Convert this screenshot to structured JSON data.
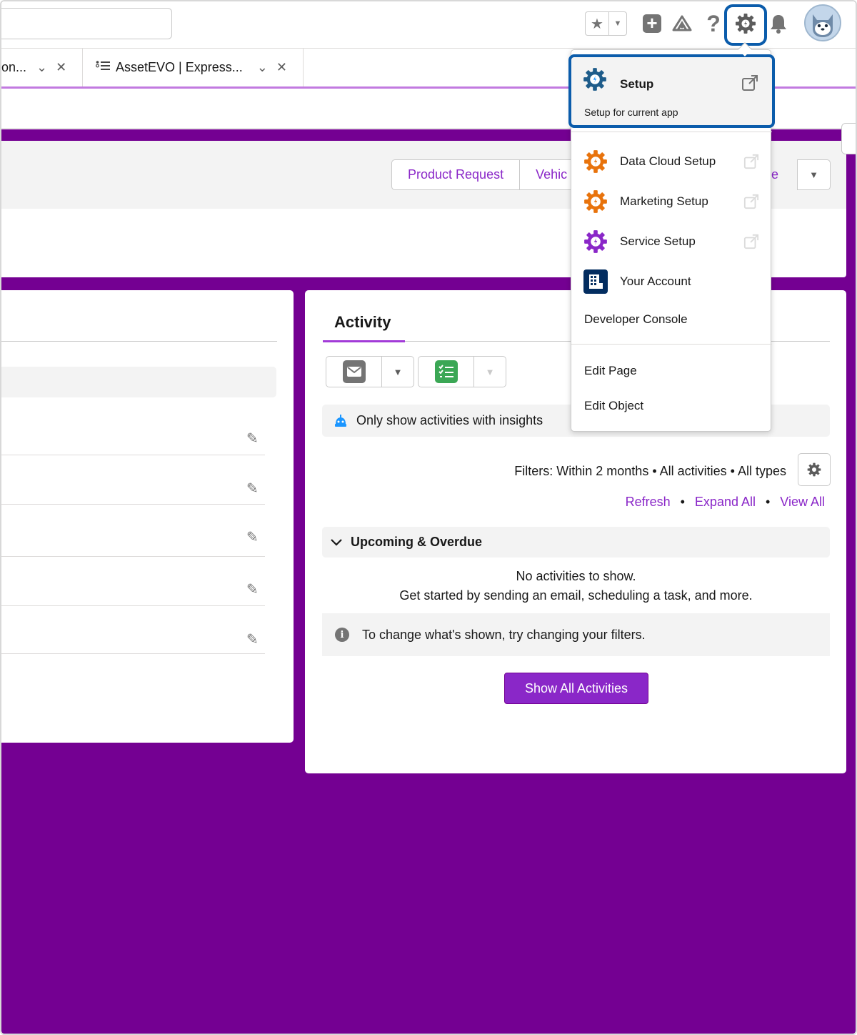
{
  "colors": {
    "brand_purple": "#740092",
    "link_purple": "#8a27c8",
    "focus_blue": "#0b5cab",
    "setup_gear": "#1e5c8a",
    "orange_gear": "#e8730c",
    "purple_gear": "#8a27c8"
  },
  "header": {
    "search_placeholder": "",
    "icons": [
      "star-icon",
      "chevron-down-icon",
      "add-icon",
      "trailhead-icon",
      "help-icon",
      "setup-gear-icon",
      "bell-icon",
      "avatar"
    ],
    "help_glyph": "?"
  },
  "tabs": [
    {
      "label": "on...",
      "icon": ""
    },
    {
      "label": "AssetEVO | Express...",
      "icon": "list-icon"
    }
  ],
  "highlights": {
    "actions": [
      "Product Request",
      "Vehic"
    ],
    "more_partial": "re"
  },
  "activity": {
    "title": "Activity",
    "insights_label": "Only show activities with insights",
    "filters": "Filters: Within 2 months • All activities • All types",
    "links": {
      "refresh": "Refresh",
      "expand": "Expand All",
      "view": "View All",
      "separator": "•"
    },
    "upcoming": "Upcoming & Overdue",
    "empty_line1": "No activities to show.",
    "empty_line2": "Get started by sending an email, scheduling a task, and more.",
    "tip": "To change what's shown, try changing your filters.",
    "show_all": "Show All Activities"
  },
  "setup_menu": {
    "setup": {
      "title": "Setup",
      "subtitle": "Setup for current app"
    },
    "items": [
      {
        "label": "Data Cloud Setup",
        "icon": "orange-gear-icon"
      },
      {
        "label": "Marketing Setup",
        "icon": "orange-gear-icon"
      },
      {
        "label": "Service Setup",
        "icon": "purple-gear-icon"
      },
      {
        "label": "Your Account",
        "icon": "building-icon"
      },
      {
        "label": "Developer Console",
        "icon": ""
      }
    ],
    "edit_items": [
      "Edit Page",
      "Edit Object"
    ]
  }
}
